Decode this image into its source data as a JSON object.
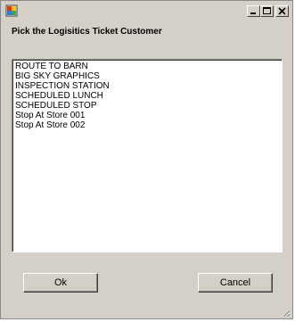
{
  "dialog": {
    "prompt": "Pick the Logisitics Ticket Customer",
    "customers": [
      "ROUTE TO BARN",
      "BIG SKY GRAPHICS",
      "INSPECTION STATION",
      "SCHEDULED LUNCH",
      "SCHEDULED STOP",
      "Stop At Store 001",
      "Stop At Store 002"
    ],
    "ok_label": "Ok",
    "cancel_label": "Cancel"
  },
  "icons": {
    "app": "app-icon",
    "minimize": "minimize-icon",
    "maximize": "maximize-icon",
    "close": "close-icon",
    "resize": "resize-grip-icon"
  },
  "colors": {
    "window_background": "#d4d0c8",
    "list_background": "#ffffff",
    "text": "#000000"
  }
}
